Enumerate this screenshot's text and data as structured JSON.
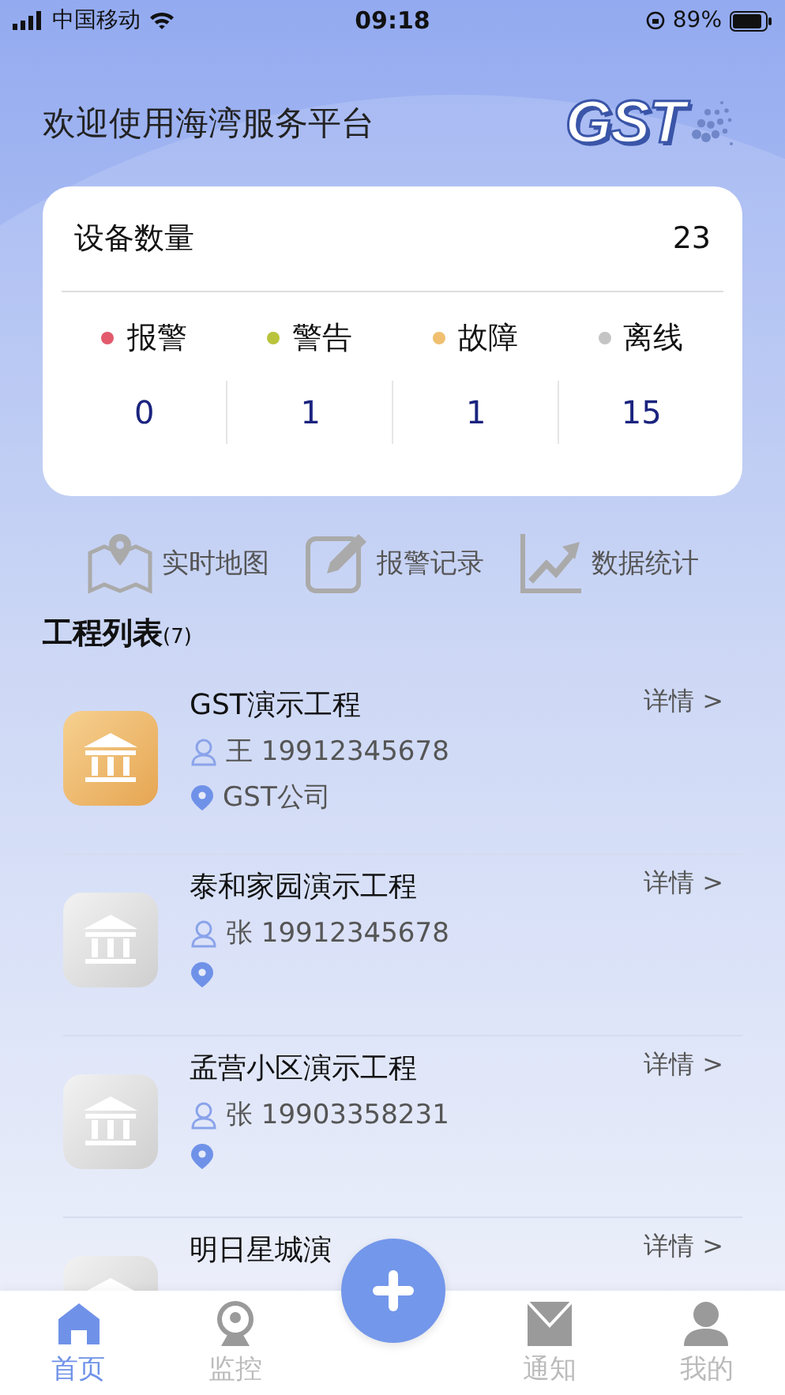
{
  "status_bar": {
    "carrier": "中国移动",
    "time": "09:18",
    "battery": "89%"
  },
  "header": {
    "title": "欢迎使用海湾服务平台",
    "logo": "GST"
  },
  "summary": {
    "label": "设备数量",
    "count": "23",
    "stats": [
      {
        "label": "报警",
        "value": "0",
        "color": "#e25a6c"
      },
      {
        "label": "警告",
        "value": "1",
        "color": "#b9c43c"
      },
      {
        "label": "故障",
        "value": "1",
        "color": "#f0c070"
      },
      {
        "label": "离线",
        "value": "15",
        "color": "#c4c4c4"
      }
    ]
  },
  "shortcuts": [
    {
      "kind": "map",
      "label": "实时地图"
    },
    {
      "kind": "edit",
      "label": "报警记录"
    },
    {
      "kind": "chart",
      "label": "数据统计"
    }
  ],
  "projects": {
    "title": "工程列表",
    "count": "(7)",
    "items": [
      {
        "name": "GST演示工程",
        "online": true,
        "contact": "王 19912345678",
        "address": "GST公司",
        "detail": "详情 >"
      },
      {
        "name": "泰和家园演示工程",
        "online": false,
        "contact": "张 19912345678",
        "detail": "详情 >"
      },
      {
        "name": "孟营小区演示工程",
        "online": false,
        "contact": "张 19903358231",
        "detail": "详情 >"
      },
      {
        "name": "明日星城演",
        "online": false,
        "detail": "详情 >"
      }
    ]
  },
  "tabs": [
    {
      "kind": "home",
      "label": "首页",
      "selected": true
    },
    {
      "kind": "camera",
      "label": "监控",
      "selected": false
    },
    {
      "kind": "add"
    },
    {
      "kind": "mail",
      "label": "通知",
      "selected": false
    },
    {
      "kind": "user",
      "label": "我的",
      "selected": false
    }
  ]
}
